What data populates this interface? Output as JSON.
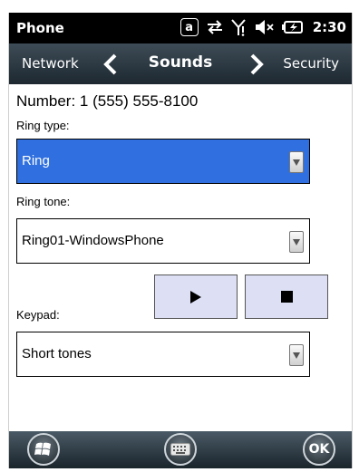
{
  "statusbar": {
    "app_title": "Phone",
    "badge_letter": "a",
    "time": "2:30"
  },
  "navbar": {
    "prev_label": "Network",
    "title": "Sounds",
    "next_label": "Security"
  },
  "content": {
    "number_line": "Number: 1 (555) 555-8100",
    "ring_type_label": "Ring type:",
    "ring_type_value": "Ring",
    "ring_tone_label": "Ring tone:",
    "ring_tone_value": "Ring01-WindowsPhone",
    "keypad_label": "Keypad:",
    "keypad_value": "Short tones"
  },
  "bottombar": {
    "ok_label": "OK"
  },
  "colors": {
    "selection": "#2f6fdf",
    "play_stop_button_bg": "#dde0f4",
    "navbar_top": "#3e4c57",
    "navbar_bottom": "#1d2830"
  }
}
